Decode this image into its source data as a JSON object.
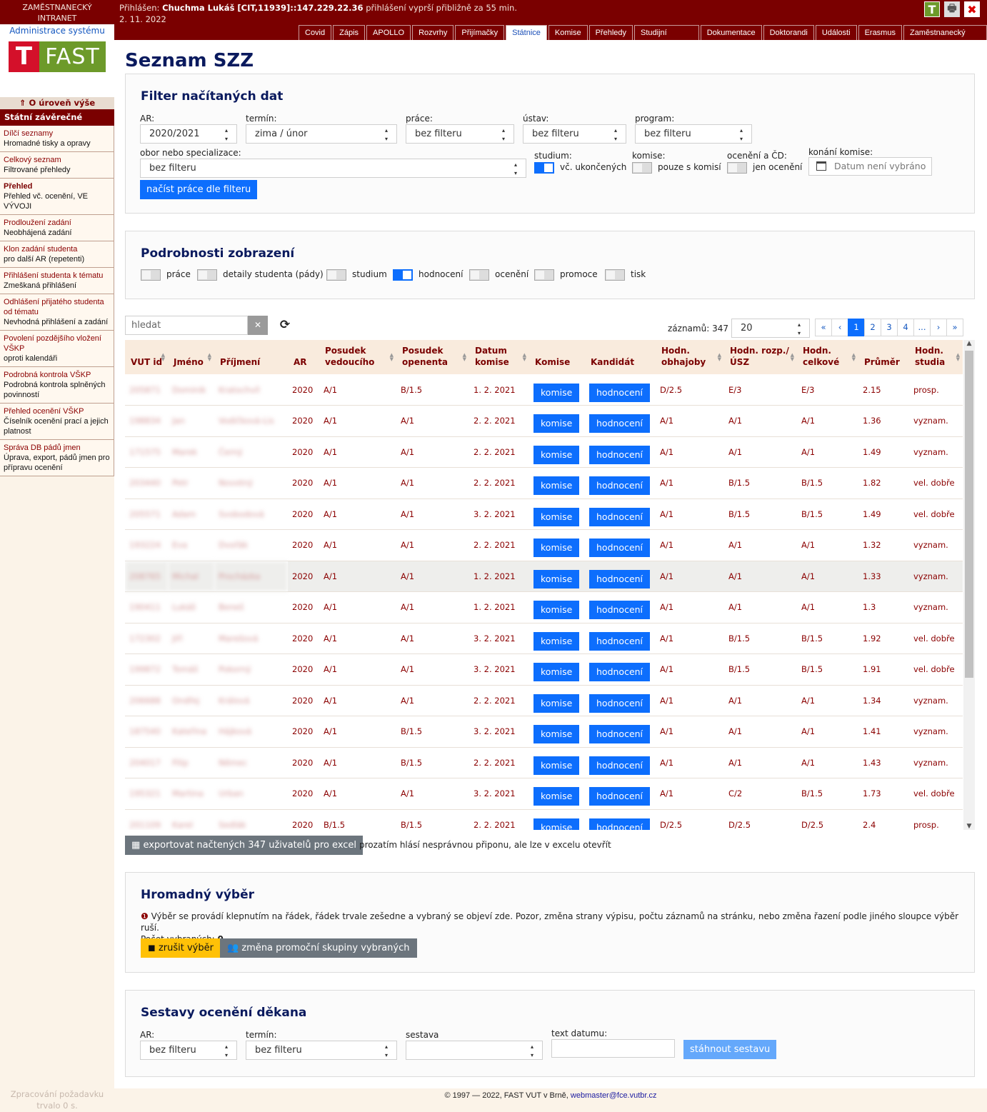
{
  "header": {
    "brand_line1": "ZAMĚSTNANECKÝ",
    "brand_line2": "INTRANET",
    "admin_link": "Administrace systému",
    "logo_letter": "T",
    "logo_text": "FAST",
    "login_label": "Přihlášen:",
    "login_user": "Chuchma Lukáš [CIT,11939]::147.229.22.36",
    "login_expiry": "přihlášení vyprší přibližně za 55 min.",
    "date": "2. 11. 2022",
    "icons": [
      "t-icon",
      "print-icon",
      "close-icon"
    ],
    "tabs": [
      {
        "label": "Covid",
        "active": false
      },
      {
        "label": "Zápis",
        "active": false
      },
      {
        "label": "APOLLO",
        "active": false
      },
      {
        "label": "Rozvrhy",
        "active": false
      },
      {
        "label": "Přijímačky",
        "active": false
      },
      {
        "label": "Státnice",
        "active": true
      },
      {
        "label": "Komise",
        "active": false
      },
      {
        "label": "Přehledy",
        "active": false
      },
      {
        "label": "Studijní programy",
        "active": false
      },
      {
        "label": "Dokumentace",
        "active": false
      },
      {
        "label": "Doktorandi",
        "active": false
      },
      {
        "label": "Události",
        "active": false
      },
      {
        "label": "Erasmus",
        "active": false
      },
      {
        "label": "Zaměstnanecký intranet",
        "active": false
      }
    ]
  },
  "sidebar": {
    "up_label": "O úroveň výše",
    "section_title": "Státní závěrečné zkoušky",
    "items": [
      {
        "title": "Dílčí seznamy",
        "desc": "Hromadné tisky a opravy"
      },
      {
        "title": "Celkový seznam",
        "desc": "Filtrované přehledy"
      },
      {
        "title": "Přehled",
        "desc": "Přehled vč. ocenění, VE VÝVOJI"
      },
      {
        "title": "Prodloužení zadání",
        "desc": "Neobhájená zadání"
      },
      {
        "title": "Klon zadání studenta",
        "desc": "pro další AR (repetenti)"
      },
      {
        "title": "Přihlášení studenta k tématu",
        "desc": "Zmeškaná přihlášení"
      },
      {
        "title": "Odhlášení přijatého studenta od tématu",
        "desc": "Nevhodná přihlášení a zadání"
      },
      {
        "title": "Povolení pozdějšího vložení VŠKP",
        "desc": "oproti kalendáři"
      },
      {
        "title": "Podrobná kontrola VŠKP",
        "desc": "Podrobná kontrola splněných povinností"
      },
      {
        "title": "Přehled ocenění VŠKP",
        "desc": "Číselník ocenění prací a jejich platnost"
      },
      {
        "title": "Správa DB pádů jmen",
        "desc": "Úprava, export, pádů jmen pro přípravu ocenění"
      }
    ],
    "footer_line1": "Zpracování požadavku",
    "footer_line2": "trvalo 0 s."
  },
  "page": {
    "title": "Seznam SZZ"
  },
  "filter": {
    "title": "Filter načítaných dat",
    "ar_label": "AR:",
    "ar_value": "2020/2021",
    "termin_label": "termín:",
    "termin_value": "zima / únor",
    "prace_label": "práce:",
    "prace_value": "bez filteru",
    "ustav_label": "ústav:",
    "ustav_value": "bez filteru",
    "program_label": "program:",
    "program_value": "bez filteru",
    "obor_label": "obor nebo specializace:",
    "obor_value": "bez filteru",
    "studium_label": "studium:",
    "studium_toggle": "vč. ukončených",
    "komise_label": "komise:",
    "komise_toggle": "pouze s komisí",
    "oceneni_label": "ocenění a ČD:",
    "oceneni_toggle": "jen ocenění",
    "konani_label": "konání komise:",
    "konani_placeholder": "Datum není vybráno",
    "load_button": "načíst práce dle filteru"
  },
  "details": {
    "title": "Podrobnosti zobrazení",
    "toggles": [
      {
        "label": "práce",
        "on": false
      },
      {
        "label": "detaily studenta (pády)",
        "on": false
      },
      {
        "label": "studium",
        "on": false
      },
      {
        "label": "hodnocení",
        "on": true
      },
      {
        "label": "ocenění",
        "on": false
      },
      {
        "label": "promoce",
        "on": false
      },
      {
        "label": "tisk",
        "on": false
      }
    ]
  },
  "list": {
    "search_placeholder": "hledat",
    "count_label": "záznamů: 347",
    "page_size": "20",
    "pages": [
      "«",
      "‹",
      "1",
      "2",
      "3",
      "4",
      "...",
      "›",
      "»"
    ],
    "headers": [
      "VUT id",
      "Jméno",
      "Příjmení",
      "AR",
      "Posudek vedoucího",
      "Posudek openenta",
      "Datum komise",
      "Komise",
      "Kandidát",
      "Hodn. obhajoby",
      "Hodn. rozp./ÚSZ",
      "Hodn. celkové",
      "Průměr",
      "Hodn. studia"
    ],
    "komise_btn": "komise",
    "kandidat_btn": "hodnocení",
    "rows": [
      {
        "id": "205871",
        "first": "Dominik",
        "last": "Kratochvíl",
        "ar": "2020",
        "ved": "A/1",
        "opo": "B/1.5",
        "date": "1. 2. 2021",
        "obh": "D/2.5",
        "rozp": "E/3",
        "celk": "E/3",
        "prumer": "2.15",
        "studia": "prosp."
      },
      {
        "id": "198834",
        "first": "Jan",
        "last": "Vodičková-Lis",
        "ar": "2020",
        "ved": "A/1",
        "opo": "A/1",
        "date": "2. 2. 2021",
        "obh": "A/1",
        "rozp": "A/1",
        "celk": "A/1",
        "prumer": "1.36",
        "studia": "vyznam."
      },
      {
        "id": "171575",
        "first": "Marek",
        "last": "Černý",
        "ar": "2020",
        "ved": "A/1",
        "opo": "A/1",
        "date": "2. 2. 2021",
        "obh": "A/1",
        "rozp": "A/1",
        "celk": "A/1",
        "prumer": "1.49",
        "studia": "vyznam."
      },
      {
        "id": "203440",
        "first": "Petr",
        "last": "Novotný",
        "ar": "2020",
        "ved": "A/1",
        "opo": "A/1",
        "date": "2. 2. 2021",
        "obh": "A/1",
        "rozp": "B/1.5",
        "celk": "B/1.5",
        "prumer": "1.82",
        "studia": "vel. dobře"
      },
      {
        "id": "205571",
        "first": "Adam",
        "last": "Svobodová",
        "ar": "2020",
        "ved": "A/1",
        "opo": "A/1",
        "date": "3. 2. 2021",
        "obh": "A/1",
        "rozp": "B/1.5",
        "celk": "B/1.5",
        "prumer": "1.49",
        "studia": "vel. dobře"
      },
      {
        "id": "193224",
        "first": "Eva",
        "last": "Dvořák",
        "ar": "2020",
        "ved": "A/1",
        "opo": "A/1",
        "date": "2. 2. 2021",
        "obh": "A/1",
        "rozp": "A/1",
        "celk": "A/1",
        "prumer": "1.32",
        "studia": "vyznam."
      },
      {
        "id": "208765",
        "first": "Michal",
        "last": "Procházka",
        "ar": "2020",
        "ved": "A/1",
        "opo": "A/1",
        "date": "1. 2. 2021",
        "obh": "A/1",
        "rozp": "A/1",
        "celk": "A/1",
        "prumer": "1.33",
        "studia": "vyznam."
      },
      {
        "id": "190411",
        "first": "Lukáš",
        "last": "Beneš",
        "ar": "2020",
        "ved": "A/1",
        "opo": "A/1",
        "date": "1. 2. 2021",
        "obh": "A/1",
        "rozp": "A/1",
        "celk": "A/1",
        "prumer": "1.3",
        "studia": "vyznam."
      },
      {
        "id": "172302",
        "first": "Jiří",
        "last": "Marešová",
        "ar": "2020",
        "ved": "A/1",
        "opo": "A/1",
        "date": "3. 2. 2021",
        "obh": "A/1",
        "rozp": "B/1.5",
        "celk": "B/1.5",
        "prumer": "1.92",
        "studia": "vel. dobře"
      },
      {
        "id": "199872",
        "first": "Tomáš",
        "last": "Pokorný",
        "ar": "2020",
        "ved": "A/1",
        "opo": "A/1",
        "date": "3. 2. 2021",
        "obh": "A/1",
        "rozp": "B/1.5",
        "celk": "B/1.5",
        "prumer": "1.91",
        "studia": "vel. dobře"
      },
      {
        "id": "206688",
        "first": "Ondřej",
        "last": "Králová",
        "ar": "2020",
        "ved": "A/1",
        "opo": "A/1",
        "date": "2. 2. 2021",
        "obh": "A/1",
        "rozp": "A/1",
        "celk": "A/1",
        "prumer": "1.34",
        "studia": "vyznam."
      },
      {
        "id": "187540",
        "first": "Kateřina",
        "last": "Hájková",
        "ar": "2020",
        "ved": "A/1",
        "opo": "B/1.5",
        "date": "3. 2. 2021",
        "obh": "A/1",
        "rozp": "A/1",
        "celk": "A/1",
        "prumer": "1.41",
        "studia": "vyznam."
      },
      {
        "id": "204017",
        "first": "Filip",
        "last": "Němec",
        "ar": "2020",
        "ved": "A/1",
        "opo": "B/1.5",
        "date": "2. 2. 2021",
        "obh": "A/1",
        "rozp": "A/1",
        "celk": "A/1",
        "prumer": "1.43",
        "studia": "vyznam."
      },
      {
        "id": "195321",
        "first": "Martina",
        "last": "Urban",
        "ar": "2020",
        "ved": "A/1",
        "opo": "A/1",
        "date": "3. 2. 2021",
        "obh": "A/1",
        "rozp": "C/2",
        "celk": "B/1.5",
        "prumer": "1.73",
        "studia": "vel. dobře"
      },
      {
        "id": "201109",
        "first": "Karel",
        "last": "Sedlák",
        "ar": "2020",
        "ved": "B/1.5",
        "opo": "B/1.5",
        "date": "2. 2. 2021",
        "obh": "D/2.5",
        "rozp": "D/2.5",
        "celk": "D/2.5",
        "prumer": "2.4",
        "studia": "prosp."
      }
    ],
    "export_button": "exportovat načtených 347 uživatelů pro excel",
    "export_note": "prozatím hlásí nesprávnou připonu, ale lze v excelu otevřít"
  },
  "bulk": {
    "title": "Hromadný výběr",
    "info": "Výběr se provádí klepnutím na řádek, řádek trvale zešedne a vybraný se objeví zde. Pozor, změna strany výpisu, počtu záznamů na stránku, nebo změna řazení podle jiného sloupce výběr ruší.",
    "count_label": "Počet vybraných:",
    "count_value": "0.",
    "cancel_button": "zrušit výběr",
    "group_button": "změna promoční skupiny vybraných"
  },
  "reports": {
    "title": "Sestavy ocenění děkana",
    "ar_label": "AR:",
    "ar_value": "bez filteru",
    "termin_label": "termín:",
    "termin_value": "bez filteru",
    "sestava_label": "sestava",
    "sestava_value": "",
    "text_label": "text datumu:",
    "text_value": "",
    "download_button": "stáhnout sestavu"
  },
  "footer": {
    "text": "© 1997 — 2022, FAST VUT v Brně,",
    "email": "webmaster@fce.vutbr.cz"
  }
}
